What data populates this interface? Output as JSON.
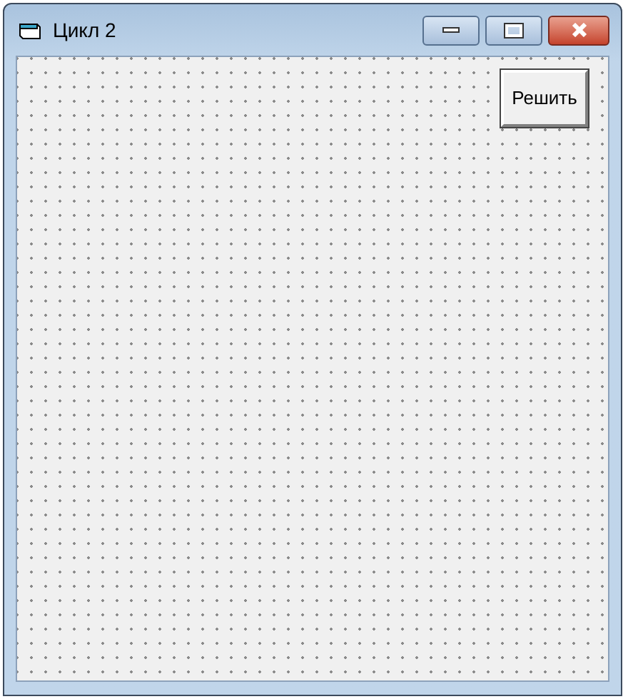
{
  "window": {
    "title": "Цикл 2"
  },
  "form": {
    "buttons": [
      {
        "label": "Решить"
      }
    ]
  }
}
